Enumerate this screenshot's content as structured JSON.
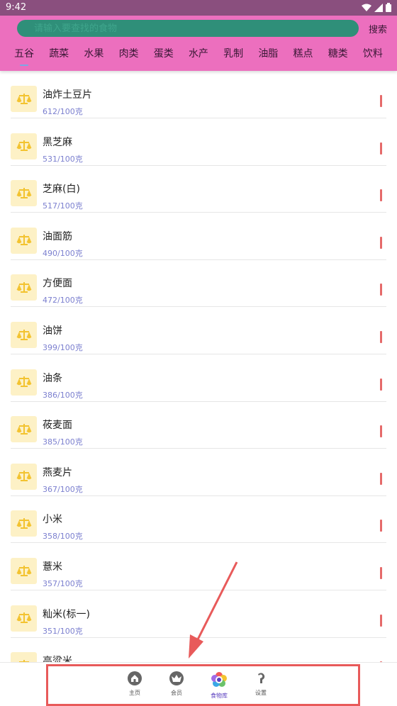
{
  "status_bar": {
    "time": "9:42"
  },
  "search": {
    "placeholder": "请输入要查找的食物",
    "button_label": "搜索"
  },
  "tabs": [
    {
      "label": "五谷",
      "active": true
    },
    {
      "label": "蔬菜"
    },
    {
      "label": "水果"
    },
    {
      "label": "肉类"
    },
    {
      "label": "蛋类"
    },
    {
      "label": "水产"
    },
    {
      "label": "乳制"
    },
    {
      "label": "油脂"
    },
    {
      "label": "糕点"
    },
    {
      "label": "糖类"
    },
    {
      "label": "饮料"
    }
  ],
  "foods": [
    {
      "name": "油炸土豆片",
      "calories": "612/100克"
    },
    {
      "name": "黑芝麻",
      "calories": "531/100克"
    },
    {
      "name": "芝麻(白)",
      "calories": "517/100克"
    },
    {
      "name": "油面筋",
      "calories": "490/100克"
    },
    {
      "name": "方便面",
      "calories": "472/100克"
    },
    {
      "name": "油饼",
      "calories": "399/100克"
    },
    {
      "name": "油条",
      "calories": "386/100克"
    },
    {
      "name": "莜麦面",
      "calories": "385/100克"
    },
    {
      "name": "燕麦片",
      "calories": "367/100克"
    },
    {
      "name": "小米",
      "calories": "358/100克"
    },
    {
      "name": "薏米",
      "calories": "357/100克"
    },
    {
      "name": "籼米(标一)",
      "calories": "351/100克"
    },
    {
      "name": "高粱米",
      "calories": ""
    }
  ],
  "bottom_nav": [
    {
      "label": "主页",
      "icon": "home-icon"
    },
    {
      "label": "会员",
      "icon": "crown-icon"
    },
    {
      "label": "食物库",
      "icon": "food-library-icon",
      "active": true
    },
    {
      "label": "设置",
      "icon": "settings-icon"
    }
  ],
  "colors": {
    "header": "#ec6fbe",
    "status_bar": "#8a4f7e",
    "search_field": "#2f8f79",
    "calorie_text": "#7b7fcf",
    "level_bar": "#e56a6a",
    "annotation": "#e85a5a"
  }
}
